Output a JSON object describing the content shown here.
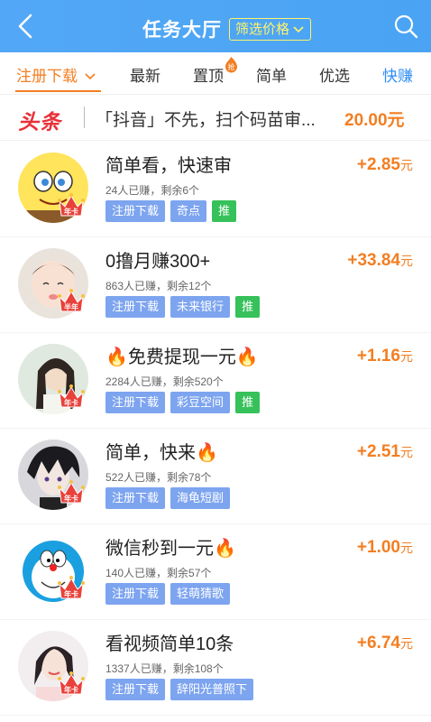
{
  "header": {
    "title": "任务大厅",
    "filter_label": "筛选价格",
    "colors": {
      "bar": "#4aa3f3",
      "filter": "#fff36a"
    }
  },
  "tabs": [
    {
      "label": "注册下载",
      "style": "orange",
      "has_dropdown": true
    },
    {
      "label": "最新"
    },
    {
      "label": "置顶",
      "badge": "抢"
    },
    {
      "label": "简单"
    },
    {
      "label": "优选"
    },
    {
      "label": "快赚",
      "style": "blue"
    }
  ],
  "headline": {
    "logo": "头条",
    "text": "「抖音」不先，扫个码苗审...",
    "amount": "20.00元"
  },
  "tasks": [
    {
      "title": "简单看，快速审",
      "meta": "24人已赚，剩余6个",
      "tags": [
        "注册下载",
        "奇点",
        "推"
      ],
      "amount": "+2.85",
      "unit": "元",
      "badge": "年卡",
      "avatar": "sponge"
    },
    {
      "title": "0撸月赚300+",
      "meta": "863人已赚，剩余12个",
      "tags": [
        "注册下载",
        "未来银行",
        "推"
      ],
      "amount": "+33.84",
      "unit": "元",
      "badge": "半年",
      "avatar": "baby"
    },
    {
      "title": "🔥免费提现一元🔥",
      "meta": "2284人已赚，剩余520个",
      "tags": [
        "注册下载",
        "彩豆空间",
        "推"
      ],
      "amount": "+1.16",
      "unit": "元",
      "badge": "年卡",
      "avatar": "girl"
    },
    {
      "title": "简单，快来🔥",
      "meta": "522人已赚，剩余78个",
      "tags": [
        "注册下载",
        "海龟短剧"
      ],
      "amount": "+2.51",
      "unit": "元",
      "badge": "年卡",
      "avatar": "anime"
    },
    {
      "title": "微信秒到一元🔥",
      "meta": "140人已赚，剩余57个",
      "tags": [
        "注册下载",
        "轻萌猜歌"
      ],
      "amount": "+1.00",
      "unit": "元",
      "badge": "年卡",
      "avatar": "doraemon"
    },
    {
      "title": "看视频简单10条",
      "meta": "1337人已赚，剩余108个",
      "tags": [
        "注册下载",
        "辞阳光普照下"
      ],
      "amount": "+6.74",
      "unit": "元",
      "badge": "年卡",
      "avatar": "woman"
    }
  ]
}
